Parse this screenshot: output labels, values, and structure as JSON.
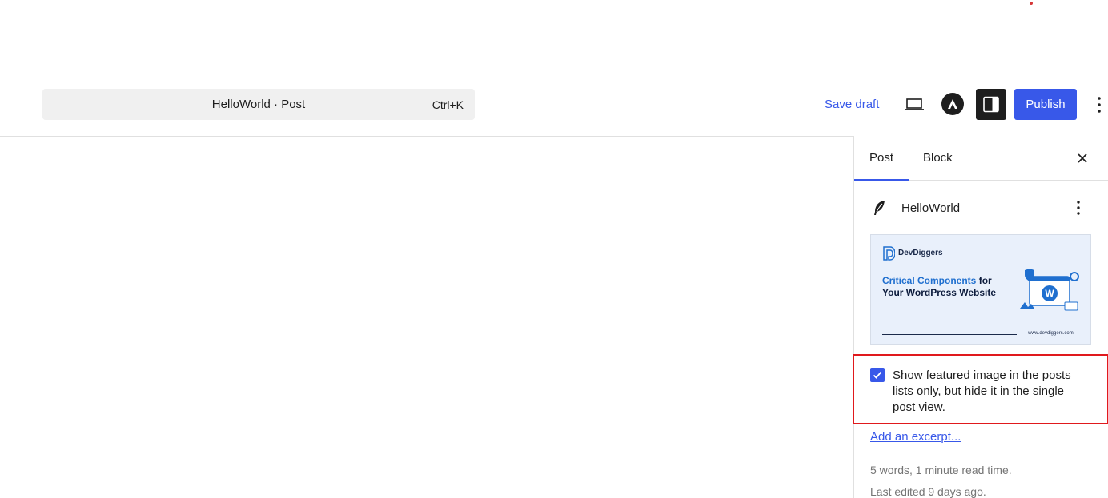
{
  "header": {
    "command_bar": {
      "title": "HelloWorld · Post",
      "shortcut": "Ctrl+K"
    },
    "save_draft_label": "Save draft",
    "publish_label": "Publish",
    "accent_color": "#3858e9"
  },
  "sidebar": {
    "tabs": [
      {
        "label": "Post",
        "active": true
      },
      {
        "label": "Block",
        "active": false
      }
    ],
    "post": {
      "title": "HelloWorld"
    },
    "featured_image": {
      "brand": "DevDiggers",
      "headline_accent": "Critical Components",
      "headline_rest": " for Your WordPress Website",
      "url": "www.devdiggers.com"
    },
    "featured_option": {
      "checked": true,
      "label": "Show featured image in the posts lists only, but hide it in the single post view."
    },
    "excerpt_link": "Add an excerpt...",
    "word_count": "5 words, 1 minute read time.",
    "last_edited": "Last edited 9 days ago."
  }
}
